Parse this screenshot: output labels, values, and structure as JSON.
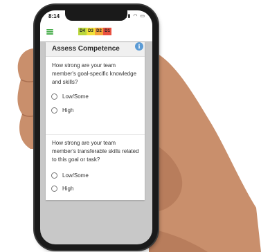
{
  "status": {
    "time": "8:14",
    "icons": "▮▮ ◠ ▭"
  },
  "appbar": {
    "levels": [
      {
        "label": "D4",
        "color": "#b9d63c"
      },
      {
        "label": "D3",
        "color": "#f2e13a"
      },
      {
        "label": "D2",
        "color": "#f5a33a"
      },
      {
        "label": "D1",
        "color": "#e85040"
      }
    ]
  },
  "card": {
    "title": "Assess Competence",
    "questions": [
      {
        "text": "How strong are your team member's goal-specific knowledge and skills?",
        "options": [
          "Low/Some",
          "High"
        ]
      },
      {
        "text": "How strong are your team member's transferable skills related to this goal or task?",
        "options": [
          "Low/Some",
          "High"
        ]
      }
    ]
  },
  "colors": {
    "menu_accent": "#4caf50",
    "info_accent": "#5b9bd5",
    "screen_background": "#c8c8c8"
  }
}
